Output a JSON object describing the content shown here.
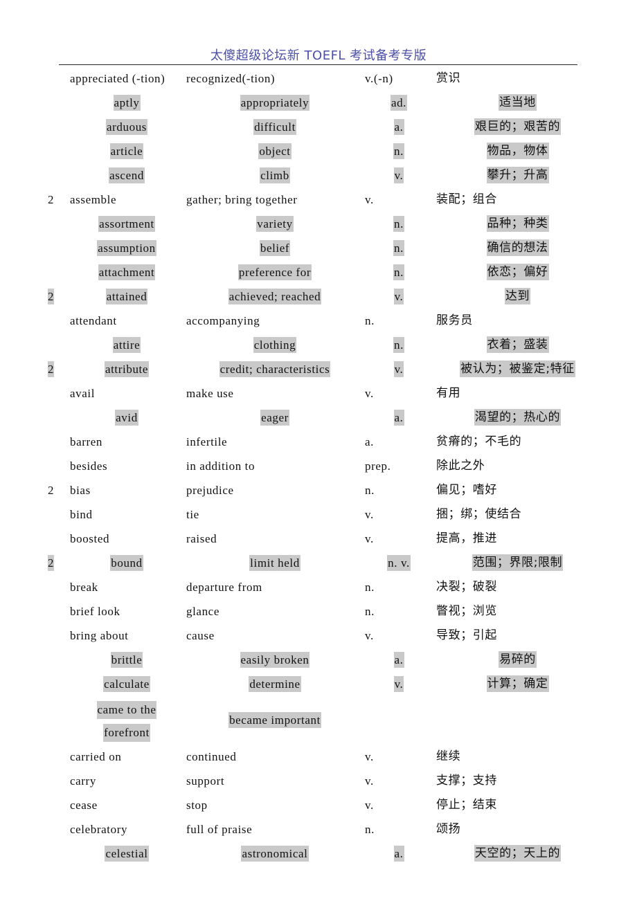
{
  "header": {
    "title": "太傻超级论坛新 TOEFL 考试备考专版",
    "title_color": "#4b4fa6"
  },
  "highlight_color": "#c9c9c9",
  "rows": [
    {
      "mark": "",
      "word": "appreciated (-tion)",
      "synonym": "recognized(-tion)",
      "pos": "v.(-n)",
      "chinese": "赏识",
      "highlighted": false
    },
    {
      "mark": "",
      "word": "aptly",
      "synonym": "appropriately",
      "pos": "ad.",
      "chinese": "适当地",
      "highlighted": true
    },
    {
      "mark": "",
      "word": "arduous",
      "synonym": "difficult",
      "pos": "a.",
      "chinese": "艰巨的；艰苦的",
      "highlighted": true
    },
    {
      "mark": "",
      "word": "article",
      "synonym": "object",
      "pos": "n.",
      "chinese": "物品，物体",
      "highlighted": true
    },
    {
      "mark": "",
      "word": "ascend",
      "synonym": "climb",
      "pos": "v.",
      "chinese": "攀升；升高",
      "highlighted": true
    },
    {
      "mark": "2",
      "word": "assemble",
      "synonym": "gather; bring together",
      "pos": "v.",
      "chinese": "装配；组合",
      "highlighted": false
    },
    {
      "mark": "",
      "word": "assortment",
      "synonym": "variety",
      "pos": "n.",
      "chinese": "品种；种类",
      "highlighted": true
    },
    {
      "mark": "",
      "word": "assumption",
      "synonym": "belief",
      "pos": "n.",
      "chinese": "确信的想法",
      "highlighted": true
    },
    {
      "mark": "",
      "word": "attachment",
      "synonym": "preference for",
      "pos": "n.",
      "chinese": "依恋；偏好",
      "highlighted": true
    },
    {
      "mark": "2",
      "word": "attained",
      "synonym": "achieved; reached",
      "pos": "v.",
      "chinese": "达到",
      "highlighted": true
    },
    {
      "mark": "",
      "word": "attendant",
      "synonym": "accompanying",
      "pos": "n.",
      "chinese": "服务员",
      "highlighted": false
    },
    {
      "mark": "",
      "word": "attire",
      "synonym": "clothing",
      "pos": "n.",
      "chinese": "衣着；盛装",
      "highlighted": true
    },
    {
      "mark": "2",
      "word": "attribute",
      "synonym": "credit; characteristics",
      "pos": "v.",
      "chinese": "被认为；被鉴定;特征",
      "highlighted": true
    },
    {
      "mark": "",
      "word": "avail",
      "synonym": "make use",
      "pos": "v.",
      "chinese": "有用",
      "highlighted": false
    },
    {
      "mark": "",
      "word": "avid",
      "synonym": "eager",
      "pos": "a.",
      "chinese": "渴望的；热心的",
      "highlighted": true
    },
    {
      "mark": "",
      "word": "barren",
      "synonym": "infertile",
      "pos": "a.",
      "chinese": "贫瘠的；不毛的",
      "highlighted": false
    },
    {
      "mark": "",
      "word": "besides",
      "synonym": "in addition to",
      "pos": "prep.",
      "chinese": "除此之外",
      "highlighted": false
    },
    {
      "mark": "2",
      "word": "bias",
      "synonym": "prejudice",
      "pos": "n.",
      "chinese": "偏见；嗜好",
      "highlighted": false
    },
    {
      "mark": "",
      "word": "bind",
      "synonym": "tie",
      "pos": "v.",
      "chinese": "捆；绑；使结合",
      "highlighted": false
    },
    {
      "mark": "",
      "word": "boosted",
      "synonym": "raised",
      "pos": "v.",
      "chinese": "提高，推进",
      "highlighted": false
    },
    {
      "mark": "2",
      "word": "bound",
      "synonym": "limit held",
      "pos": "n. v.",
      "chinese": "范围；界限;限制",
      "highlighted": true
    },
    {
      "mark": "",
      "word": "break",
      "synonym": "departure from",
      "pos": "n.",
      "chinese": "决裂；破裂",
      "highlighted": false
    },
    {
      "mark": "",
      "word": "brief look",
      "synonym": "glance",
      "pos": "n.",
      "chinese": "瞥视；浏览",
      "highlighted": false
    },
    {
      "mark": "",
      "word": "bring about",
      "synonym": "cause",
      "pos": "v.",
      "chinese": "导致；引起",
      "highlighted": false
    },
    {
      "mark": "",
      "word": "brittle",
      "synonym": "easily broken",
      "pos": "a.",
      "chinese": "易碎的",
      "highlighted": true
    },
    {
      "mark": "",
      "word": "calculate",
      "synonym": "determine",
      "pos": "v.",
      "chinese": "计算；确定",
      "highlighted": true
    },
    {
      "mark": "",
      "word": "came to the forefront",
      "word_lines": [
        "came to the",
        "forefront"
      ],
      "synonym": "became important",
      "pos": "",
      "chinese": "",
      "highlighted": true
    },
    {
      "mark": "",
      "word": "carried on",
      "synonym": "continued",
      "pos": "v.",
      "chinese": "继续",
      "highlighted": false
    },
    {
      "mark": "",
      "word": "carry",
      "synonym": "support",
      "pos": "v.",
      "chinese": "支撑；支持",
      "highlighted": false
    },
    {
      "mark": "",
      "word": "cease",
      "synonym": "stop",
      "pos": "v.",
      "chinese": "停止；结束",
      "highlighted": false
    },
    {
      "mark": "",
      "word": "celebratory",
      "synonym": "full of praise",
      "pos": "n.",
      "chinese": "颂扬",
      "highlighted": false
    },
    {
      "mark": "",
      "word": "celestial",
      "synonym": "astronomical",
      "pos": "a.",
      "chinese": "天空的；天上的",
      "highlighted": true
    }
  ]
}
